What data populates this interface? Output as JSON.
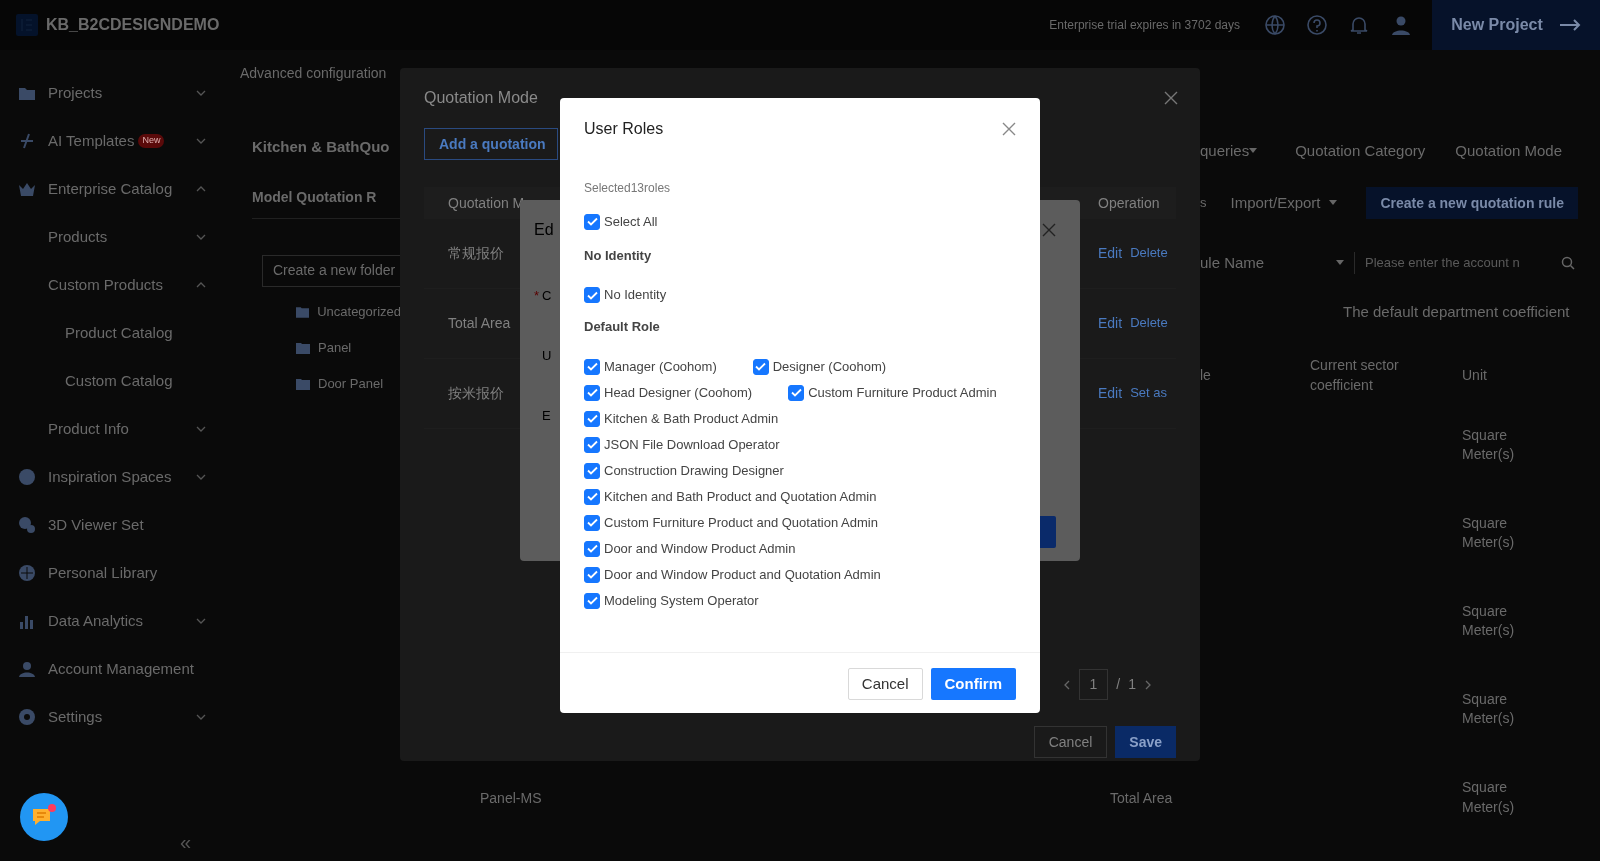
{
  "top_bar": {
    "logo_text": "KB_B2CDESIGNDEMO",
    "trial_notice": "Enterprise trial expires in 3702 days",
    "new_project": "New Project"
  },
  "sidebar": {
    "items": [
      {
        "label": "Projects",
        "expanded": false
      },
      {
        "label": "AI Templates",
        "badge": "New",
        "expanded": false
      },
      {
        "label": "Enterprise Catalog",
        "expanded": true,
        "children": [
          {
            "label": "Products",
            "expanded": false
          },
          {
            "label": "Custom Products",
            "expanded": true,
            "children": [
              {
                "label": "Product Catalog"
              },
              {
                "label": "Custom Catalog"
              }
            ]
          },
          {
            "label": "Product Info",
            "expanded": false
          }
        ]
      },
      {
        "label": "Inspiration Spaces",
        "expanded": false
      },
      {
        "label": "3D Viewer Set"
      },
      {
        "label": "Personal Library"
      },
      {
        "label": "Data Analytics",
        "expanded": false
      },
      {
        "label": "Account Management"
      },
      {
        "label": "Settings",
        "expanded": false
      }
    ],
    "collapse": "«"
  },
  "page": {
    "breadcrumb": "Advanced configuration",
    "title": "Kitchen & BathQuo",
    "tab": "Model Quotation R",
    "folder_button": "Create a new folder",
    "folders": [
      "Uncategorized",
      "Panel",
      "Door Panel"
    ],
    "header_links": [
      {
        "label": "queries",
        "dropdown": true
      },
      {
        "label": "Quotation Category",
        "dropdown": false
      },
      {
        "label": "Quotation Mode",
        "dropdown": false
      }
    ],
    "toolbar": {
      "fragment": "s",
      "import_export": "Import/Export",
      "create_rule": "Create a new quotation rule"
    },
    "filter": {
      "field": "ule Name",
      "placeholder": "Please enter the account n"
    },
    "coefficient_note": "The default department coefficient",
    "columns": [
      "le",
      "Current sector coefficient",
      "Unit"
    ],
    "units": [
      "Square Meter(s)",
      "Square Meter(s)",
      "Square Meter(s)",
      "Square Meter(s)"
    ],
    "bottom_row": {
      "name": "Panel-MS",
      "column": "Total Area",
      "unit": "Square Meter(s)"
    }
  },
  "quotation_modal": {
    "title": "Quotation Mode",
    "add_button": "Add a quotation",
    "columns": [
      "Quotation M",
      "Operation"
    ],
    "rows": [
      {
        "name": "常规报价",
        "actions": [
          "Edit",
          "Delete"
        ]
      },
      {
        "name": "Total Area",
        "actions": [
          "Edit",
          "Delete"
        ]
      },
      {
        "name": "按米报价",
        "actions": [
          "Edit",
          "Set as"
        ]
      }
    ],
    "pagination": {
      "current": "1",
      "separator": "/",
      "total": "1"
    },
    "buttons": {
      "cancel": "Cancel",
      "save": "Save"
    }
  },
  "edit_modal": {
    "title": "Ed",
    "required_mark": "*",
    "fields": [
      {
        "label": "C",
        "required": true
      },
      {
        "label": "U",
        "required": false
      },
      {
        "label": "E",
        "required": false
      }
    ]
  },
  "user_roles_modal": {
    "title": "User Roles",
    "selected_count": "Selected13roles",
    "select_all": {
      "label": "Select All",
      "checked": true
    },
    "groups": [
      {
        "heading": "No Identity",
        "rows": [
          [
            {
              "label": "No Identity",
              "checked": true
            }
          ]
        ]
      },
      {
        "heading": "Default Role",
        "rows": [
          [
            {
              "label": "Manager (Coohom)",
              "checked": true
            },
            {
              "label": "Designer (Coohom)",
              "checked": true
            }
          ],
          [
            {
              "label": "Head Designer (Coohom)",
              "checked": true
            },
            {
              "label": "Custom Furniture Product Admin",
              "checked": true
            }
          ],
          [
            {
              "label": "Kitchen & Bath Product Admin",
              "checked": true
            }
          ],
          [
            {
              "label": "JSON File Download Operator",
              "checked": true
            }
          ],
          [
            {
              "label": "Construction Drawing Designer",
              "checked": true
            }
          ],
          [
            {
              "label": "Kitchen and Bath Product and Quotation Admin",
              "checked": true
            }
          ],
          [
            {
              "label": "Custom Furniture Product and Quotation Admin",
              "checked": true
            }
          ],
          [
            {
              "label": "Door and Window Product Admin",
              "checked": true
            }
          ],
          [
            {
              "label": "Door and Window Product and Quotation Admin",
              "checked": true
            }
          ],
          [
            {
              "label": "Modeling System Operator",
              "checked": true
            }
          ]
        ]
      }
    ],
    "buttons": {
      "cancel": "Cancel",
      "confirm": "Confirm"
    }
  },
  "chat": {
    "unread": true
  }
}
